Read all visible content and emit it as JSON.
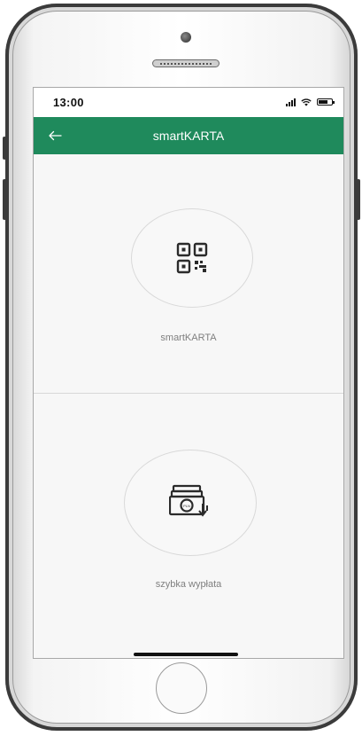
{
  "status_bar": {
    "time": "13:00",
    "icons": [
      "signal-icon",
      "wifi-icon",
      "battery-icon"
    ]
  },
  "app_bar": {
    "title": "smartKARTA",
    "back_icon": "arrow-left-icon",
    "background": "#1f8a5c"
  },
  "options": [
    {
      "label": "smartKARTA",
      "icon": "qr-code-icon"
    },
    {
      "label": "szybka wypłata",
      "icon": "cash-withdrawal-icon"
    }
  ],
  "colors": {
    "accent": "#1f8a5c",
    "screen_background": "#f7f7f7",
    "label_text": "#7f7f7f"
  }
}
